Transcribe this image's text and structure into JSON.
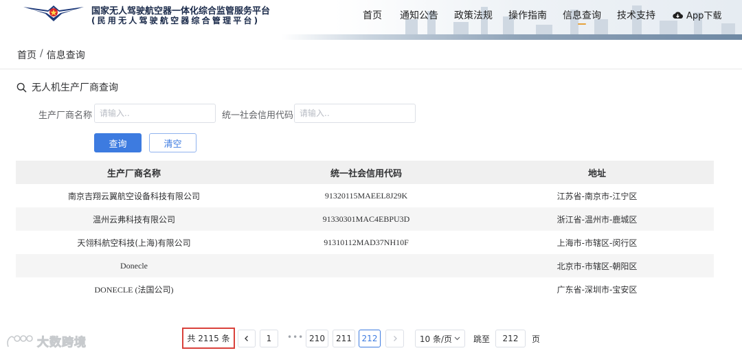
{
  "header": {
    "title_line1": "国家无人驾驶航空器一体化综合监管服务平台",
    "title_line2": "(民用无人驾驶航空器综合管理平台)",
    "nav": [
      {
        "label": "首页",
        "active": false
      },
      {
        "label": "通知公告",
        "active": false
      },
      {
        "label": "政策法规",
        "active": false
      },
      {
        "label": "操作指南",
        "active": false
      },
      {
        "label": "信息查询",
        "active": true
      },
      {
        "label": "技术支持",
        "active": false
      }
    ],
    "app_download": "App下载",
    "accent_color": "#e6a23c"
  },
  "breadcrumb": {
    "items": [
      "首页",
      "信息查询"
    ],
    "separator": "/"
  },
  "section": {
    "title": "无人机生产厂商查询",
    "icon": "search-icon"
  },
  "form": {
    "manufacturer_label": "生产厂商名称",
    "manufacturer_placeholder": "请输入..",
    "credit_code_label": "统一社会信用代码",
    "credit_code_placeholder": "请输入..",
    "query_button": "查询",
    "clear_button": "清空",
    "primary_color": "#3d7be0"
  },
  "table": {
    "headers": [
      "生产厂商名称",
      "统一社会信用代码",
      "地址"
    ],
    "rows": [
      [
        "南京吉翔云翼航空设备科技有限公司",
        "91320115MAEEL8J29K",
        "江苏省-南京市-江宁区"
      ],
      [
        "温州云弗科技有限公司",
        "91330301MAC4EBPU3D",
        "浙江省-温州市-鹿城区"
      ],
      [
        "天翎科航空科技(上海)有限公司",
        "91310112MAD37NH10F",
        "上海市-市辖区-闵行区"
      ],
      [
        "Donecle",
        "",
        "北京市-市辖区-朝阳区"
      ],
      [
        "DONECLE (法国公司)",
        "",
        "广东省-深圳市-宝安区"
      ]
    ]
  },
  "pagination": {
    "total": "共 2115 条",
    "prev": "<",
    "next": ">",
    "pages": [
      "1",
      "210",
      "211",
      "212"
    ],
    "current": "212",
    "more": "•••",
    "page_size": "10 条/页",
    "jump_label": "跳至",
    "jump_value": "212",
    "jump_suffix": "页",
    "highlight_color": "#d9403a"
  },
  "watermark": {
    "text": "大数跨境"
  }
}
